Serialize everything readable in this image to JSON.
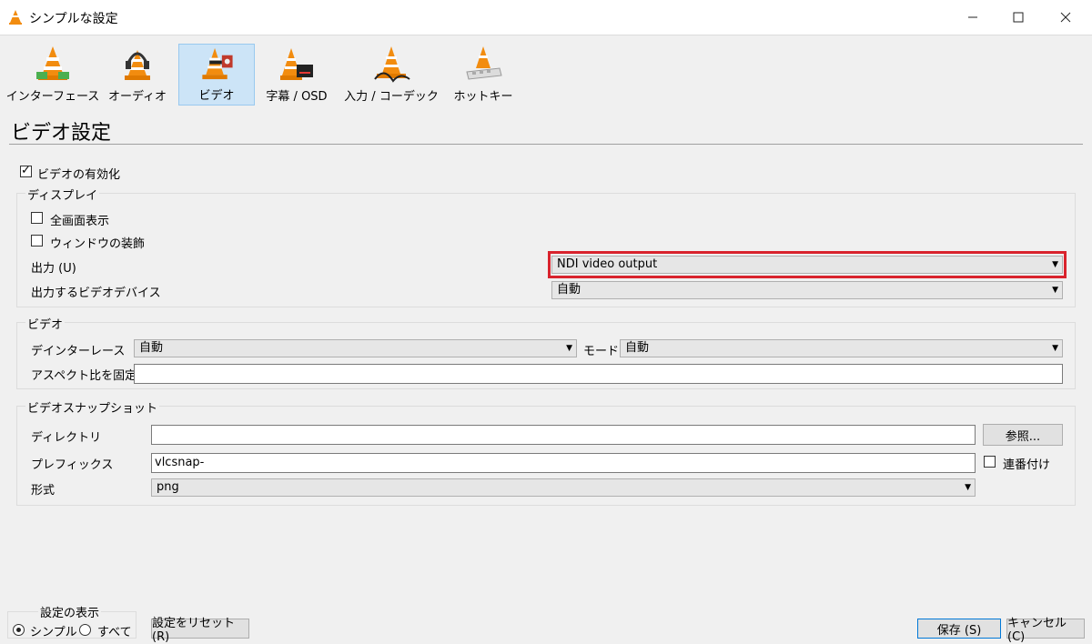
{
  "window": {
    "title": "シンプルな設定"
  },
  "toolbar": {
    "items": [
      {
        "label": "インターフェース"
      },
      {
        "label": "オーディオ"
      },
      {
        "label": "ビデオ"
      },
      {
        "label": "字幕 / OSD"
      },
      {
        "label": "入力 / コーデック"
      },
      {
        "label": "ホットキー"
      }
    ]
  },
  "page": {
    "title": "ビデオ設定"
  },
  "enable_video": {
    "label": "ビデオの有効化",
    "checked": true
  },
  "display": {
    "group_label": "ディスプレイ",
    "fullscreen_label": "全画面表示",
    "decorations_label": "ウィンドウの装飾",
    "output_label": "出力 (U)",
    "output_value": "NDI video output",
    "device_label": "出力するビデオデバイス",
    "device_value": "自動"
  },
  "video": {
    "group_label": "ビデオ",
    "deinterlace_label": "デインターレース",
    "deinterlace_value": "自動",
    "mode_label": "モード",
    "mode_value": "自動",
    "aspect_label": "アスペクト比を固定",
    "aspect_value": ""
  },
  "snapshot": {
    "group_label": "ビデオスナップショット",
    "directory_label": "ディレクトリ",
    "directory_value": "",
    "browse_label": "参照...",
    "prefix_label": "プレフィックス",
    "prefix_value": "vlcsnap-",
    "sequential_label": "連番付け",
    "format_label": "形式",
    "format_value": "png"
  },
  "footer": {
    "show_settings_label": "設定の表示",
    "simple_label": "シンプル",
    "all_label": "すべて",
    "reset_label": "設定をリセット (R)",
    "save_label": "保存 (S)",
    "cancel_label": "キャンセル (C)"
  },
  "colors": {
    "highlight": "#d9232d",
    "active_tab": "#cce4f7",
    "cone_orange": "#f28c0f"
  }
}
